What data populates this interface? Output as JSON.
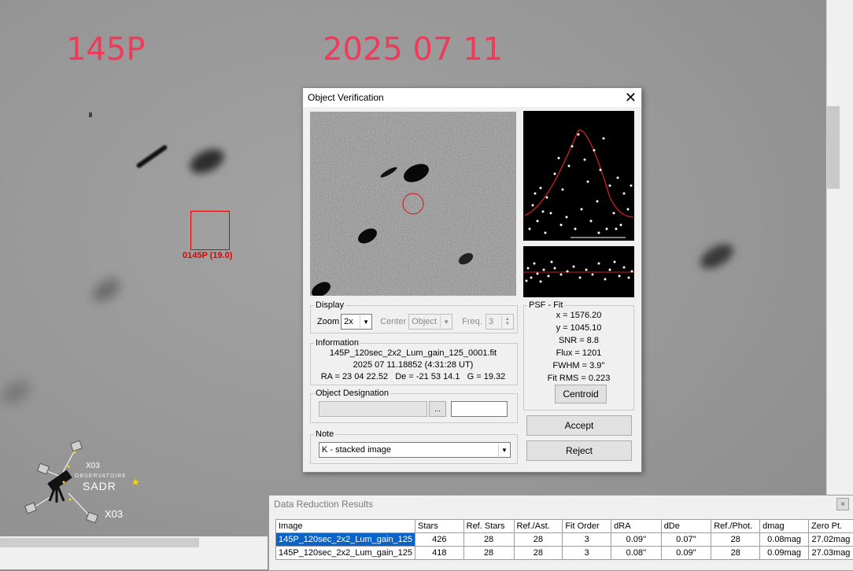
{
  "image_overlay": {
    "object_name": "145P",
    "date": "2025 07 11",
    "target_label": "0145P (19.0)",
    "logo": {
      "code_top": "X03",
      "line1": "OBSERVATOIRE",
      "line2": "SADR",
      "code_bottom": "X03"
    },
    "accent_color": "#f03a5a"
  },
  "dialog": {
    "title": "Object Verification",
    "display": {
      "legend": "Display",
      "zoom_label": "Zoom",
      "zoom_value": "2x",
      "center_label": "Center",
      "center_value": "Object",
      "freq_label": "Freq.",
      "freq_value": "3"
    },
    "information": {
      "legend": "Information",
      "filename": "145P_120sec_2x2_Lum_gain_125_0001.fit",
      "datetime": "2025 07 11.18852 (4:31:28 UT)",
      "coords": "RA = 23 04 22.52   De = -21 53 14.1   G = 19.32"
    },
    "designation": {
      "legend": "Object Designation",
      "browse": "..."
    },
    "note": {
      "legend": "Note",
      "value": "K - stacked image"
    },
    "psf": {
      "legend": "PSF - Fit",
      "x": "x = 1576.20",
      "y": "y = 1045.10",
      "snr": "SNR = 8.8",
      "flux": "Flux = 1201",
      "fwhm": "FWHM = 3.9''",
      "rms": "Fit RMS = 0.223",
      "centroid": "Centroid"
    },
    "accept": "Accept",
    "reject": "Reject"
  },
  "results": {
    "title": "Data Reduction Results",
    "close": "×",
    "columns": [
      "Image",
      "Stars",
      "Ref. Stars",
      "Ref./Ast.",
      "Fit Order",
      "dRA",
      "dDe",
      "Ref./Phot.",
      "dmag",
      "Zero Pt."
    ],
    "rows": [
      [
        "145P_120sec_2x2_Lum_gain_125",
        "426",
        "28",
        "28",
        "3",
        "0.09''",
        "0.07''",
        "28",
        "0.08mag",
        "27.02mag"
      ],
      [
        "145P_120sec_2x2_Lum_gain_125",
        "418",
        "28",
        "28",
        "3",
        "0.08''",
        "0.09''",
        "28",
        "0.09mag",
        "27.03mag"
      ]
    ]
  }
}
